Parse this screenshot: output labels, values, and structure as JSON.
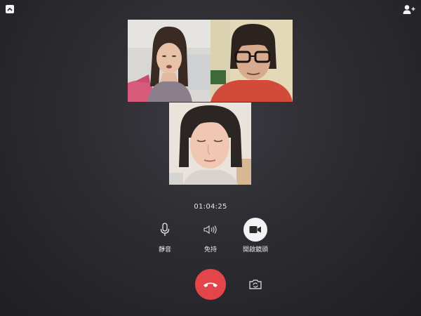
{
  "call": {
    "duration": "01:04:25"
  },
  "controls": {
    "mute_label": "靜音",
    "speaker_label": "免持",
    "camera_label": "開啟鏡頭"
  },
  "icons": {
    "collapse": "chevron-up-icon",
    "add_user": "add-user-icon",
    "mute": "microphone-icon",
    "speaker": "speaker-icon",
    "camera": "video-camera-icon",
    "end_call": "hang-up-icon",
    "switch_camera": "camera-switch-icon"
  },
  "colors": {
    "end_call": "#e3454a",
    "background": "#2c2c31",
    "control_text": "#e9e9e9"
  }
}
